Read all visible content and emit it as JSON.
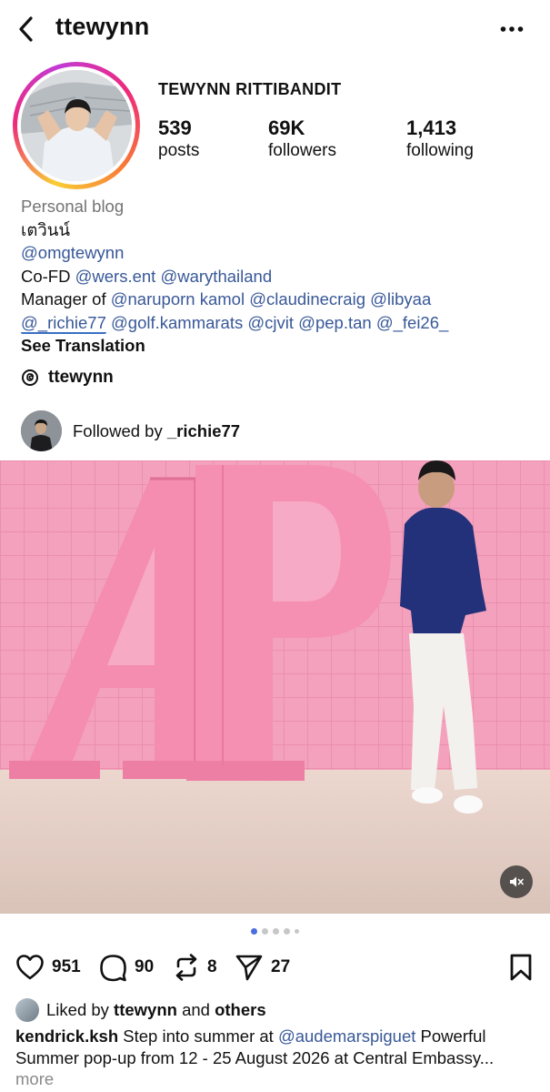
{
  "header": {
    "username": "ttewynn"
  },
  "profile": {
    "full_name": "TEWYNN RITTIBANDIT",
    "stats": [
      {
        "value": "539",
        "label": "posts"
      },
      {
        "value": "69K",
        "label": "followers"
      },
      {
        "value": "1,413",
        "label": "following"
      }
    ]
  },
  "bio": {
    "category": "Personal blog",
    "thai_name": "เตวินน์",
    "mention_1": "@omgtewynn",
    "cofd_prefix": "Co-FD ",
    "cofd_mentions": [
      "@wers.ent",
      "@warythailand"
    ],
    "manager_prefix": "Manager of ",
    "manager_mentions_1": [
      "@naruporn kamol",
      "@claudinecraig",
      "@libyaa"
    ],
    "manager_mentions_2": [
      "@_richie77",
      "@golf.kammarats",
      "@cjvit",
      "@pep.tan",
      "@_fei26_"
    ],
    "see_translation": "See Translation"
  },
  "threads": {
    "handle": "ttewynn"
  },
  "followed_by": {
    "prefix": "Followed by ",
    "user": "_richie77"
  },
  "post": {
    "carousel_count": 5,
    "carousel_active": 1,
    "likes": "951",
    "comments": "90",
    "reposts": "8",
    "shares": "27",
    "liked_by_prefix": "Liked by ",
    "liked_by_user": "ttewynn",
    "liked_by_and": " and ",
    "liked_by_others": "others",
    "caption_user": "kendrick.ksh",
    "caption_text_1": " Step into summer at ",
    "caption_mention": "@audemarspiguet",
    "caption_text_2": " Powerful Summer pop-up from 12 - 25 August 2026 at Central Embassy...",
    "caption_more": "more",
    "image_letters": "AP"
  },
  "icons": [
    "back-arrow-icon",
    "more-icon",
    "threads-icon",
    "heart-icon",
    "comment-icon",
    "repost-icon",
    "share-icon",
    "bookmark-icon",
    "mute-icon"
  ],
  "colors": {
    "mention": "#385898",
    "ring_start": "#f9ce34",
    "ring_mid": "#ee2a7b",
    "carousel_active": "#4a6ee0",
    "wall_pink": "#f29ab7"
  }
}
